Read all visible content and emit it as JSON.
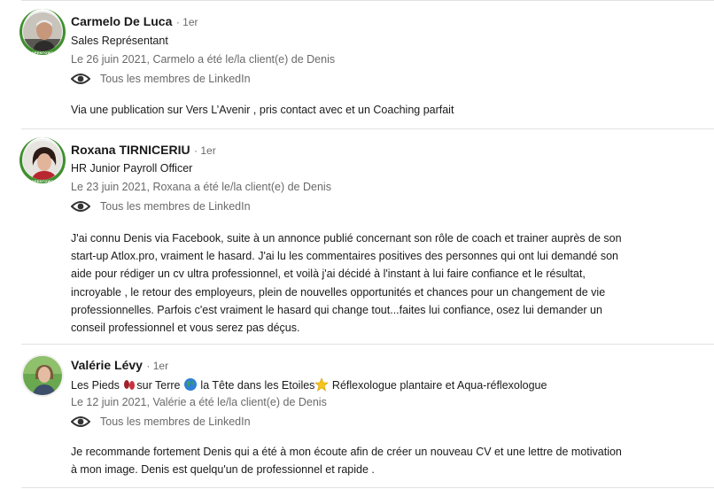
{
  "recommendations": [
    {
      "name": "Carmelo De Luca",
      "degree": "· 1er",
      "headline": "Sales Représentant",
      "meta": "Le 26 juin 2021, Carmelo a été le/la client(e) de Denis",
      "visibility": "Tous les membres de LinkedIn",
      "text": [
        "Via une publication sur Vers L’Avenir , pris contact avec et un Coaching parfait"
      ]
    },
    {
      "name": "Roxana TIRNICERIU",
      "degree": "· 1er",
      "headline": "HR Junior Payroll Officer",
      "meta": "Le 23 juin 2021, Roxana a été le/la client(e) de Denis",
      "visibility": "Tous les membres de LinkedIn",
      "text": [
        "J'ai connu Denis via Facebook, suite à un annonce publié concernant son rôle de coach et trainer auprès de son",
        "start-up Atlox.pro, vraiment le hasard. J'ai lu les commentaires positives des personnes qui ont lui demandé son",
        "aide pour rédiger un cv ultra professionnel, et voilà j'ai décidé à l'instant à lui faire confiance et le résultat,",
        "incroyable , le retour des employeurs, plein de nouvelles opportunités et chances pour un changement de vie",
        "professionnelles. Parfois c'est vraiment le hasard qui change tout...faites lui confiance, osez lui demander un",
        "conseil professionnel et vous serez pas déçus."
      ]
    },
    {
      "name": "Valérie Lévy",
      "degree": "· 1er",
      "headline_parts": [
        "Les Pieds ",
        "sur Terre ",
        " la Tête dans les Etoiles",
        " Réflexologue plantaire et Aqua-réflexologue"
      ],
      "meta": "Le 12 juin 2021, Valérie a été le/la client(e) de Denis",
      "visibility": "Tous les membres de LinkedIn",
      "text": [
        "Je recommande fortement Denis qui a été à mon écoute afin de créer un nouveau CV et une lettre de motivation",
        "à mon image. Denis est quelqu'un de professionnel et rapide ."
      ]
    }
  ],
  "open_to_work_badge": "#OPENTOWORK",
  "colors": {
    "open_to_work": "#3f8f2e",
    "separator": "#e2e2e2",
    "secondary_text": "#666666"
  },
  "icons": {
    "visibility": "eye-icon",
    "emoji_1": "footprints-icon",
    "emoji_2": "globe-icon",
    "emoji_3": "star-icon"
  }
}
